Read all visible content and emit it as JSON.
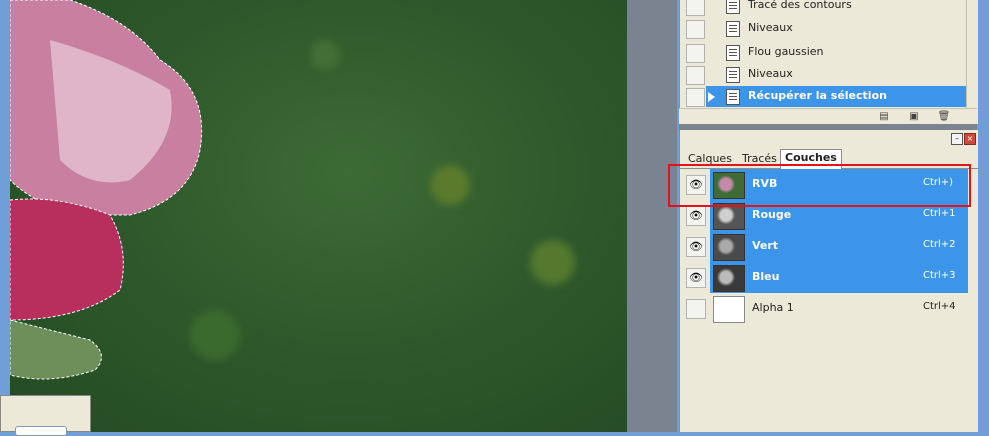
{
  "history": {
    "items": [
      {
        "label": "Tracé des contours",
        "selected": false
      },
      {
        "label": "Niveaux",
        "selected": false
      },
      {
        "label": "Flou gaussien",
        "selected": false
      },
      {
        "label": "Niveaux",
        "selected": false
      },
      {
        "label": "Récupérer la sélection",
        "selected": true
      }
    ],
    "footer_icons": [
      "new-snapshot-icon",
      "new-document-icon",
      "trash-icon"
    ]
  },
  "channels_panel": {
    "tabs": [
      "Calques",
      "Tracés",
      "Couches"
    ],
    "active_tab": "Couches",
    "channels": [
      {
        "name": "RVB",
        "shortcut": "Ctrl+)",
        "visible": true,
        "selected": true
      },
      {
        "name": "Rouge",
        "shortcut": "Ctrl+1",
        "visible": true,
        "selected": true
      },
      {
        "name": "Vert",
        "shortcut": "Ctrl+2",
        "visible": true,
        "selected": true
      },
      {
        "name": "Bleu",
        "shortcut": "Ctrl+3",
        "visible": true,
        "selected": true
      },
      {
        "name": "Alpha 1",
        "shortcut": "Ctrl+4",
        "visible": false,
        "selected": false
      }
    ]
  },
  "colors": {
    "selection_blue": "#3d95ea",
    "highlight_red": "#e0151b",
    "panel_bg": "#ece9d8"
  }
}
